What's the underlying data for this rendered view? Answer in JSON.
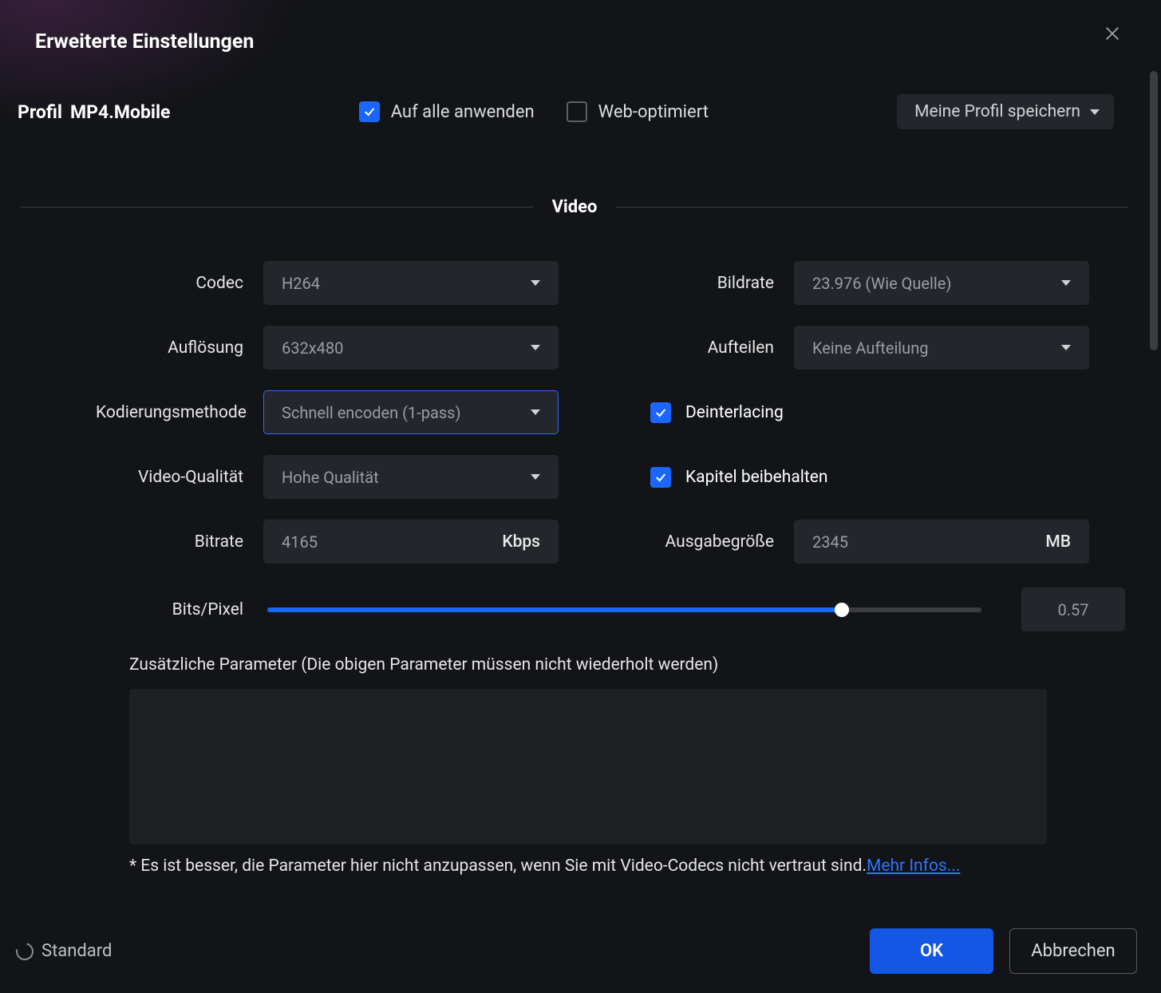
{
  "dialog": {
    "title": "Erweiterte Einstellungen"
  },
  "profile": {
    "label_prefix": "Profil",
    "name": "MP4.Mobile",
    "apply_all_label": "Auf alle anwenden",
    "apply_all_checked": true,
    "web_optimized_label": "Web-optimiert",
    "web_optimized_checked": false,
    "save_profile_label": "Meine Profil speichern"
  },
  "section": {
    "video": "Video"
  },
  "video": {
    "codec": {
      "label": "Codec",
      "value": "H264"
    },
    "framerate": {
      "label": "Bildrate",
      "value": "23.976 (Wie Quelle)"
    },
    "resolution": {
      "label": "Auflösung",
      "value": "632x480"
    },
    "split": {
      "label": "Aufteilen",
      "value": "Keine Aufteilung"
    },
    "encoding_method": {
      "label": "Kodierungsmethode",
      "value": "Schnell encoden (1-pass)"
    },
    "quality": {
      "label": "Video-Qualität",
      "value": "Hohe Qualität"
    },
    "deinterlacing": {
      "label": "Deinterlacing",
      "checked": true
    },
    "keep_chapters": {
      "label": "Kapitel beibehalten",
      "checked": true
    },
    "bitrate": {
      "label": "Bitrate",
      "value": "4165",
      "unit": "Kbps"
    },
    "output_size": {
      "label": "Ausgabegröße",
      "value": "2345",
      "unit": "MB"
    },
    "bits_per_pixel": {
      "label": "Bits/Pixel",
      "value": "0.57"
    },
    "additional_params": {
      "label": "Zusätzliche Parameter (Die obigen Parameter müssen nicht wiederholt werden)",
      "note_prefix": "* Es ist besser, die Parameter hier nicht anzupassen, wenn Sie mit Video-Codecs nicht vertraut sind.",
      "note_link": "Mehr Infos..."
    }
  },
  "footer": {
    "standard_label": "Standard",
    "ok_label": "OK",
    "cancel_label": "Abbrechen"
  }
}
